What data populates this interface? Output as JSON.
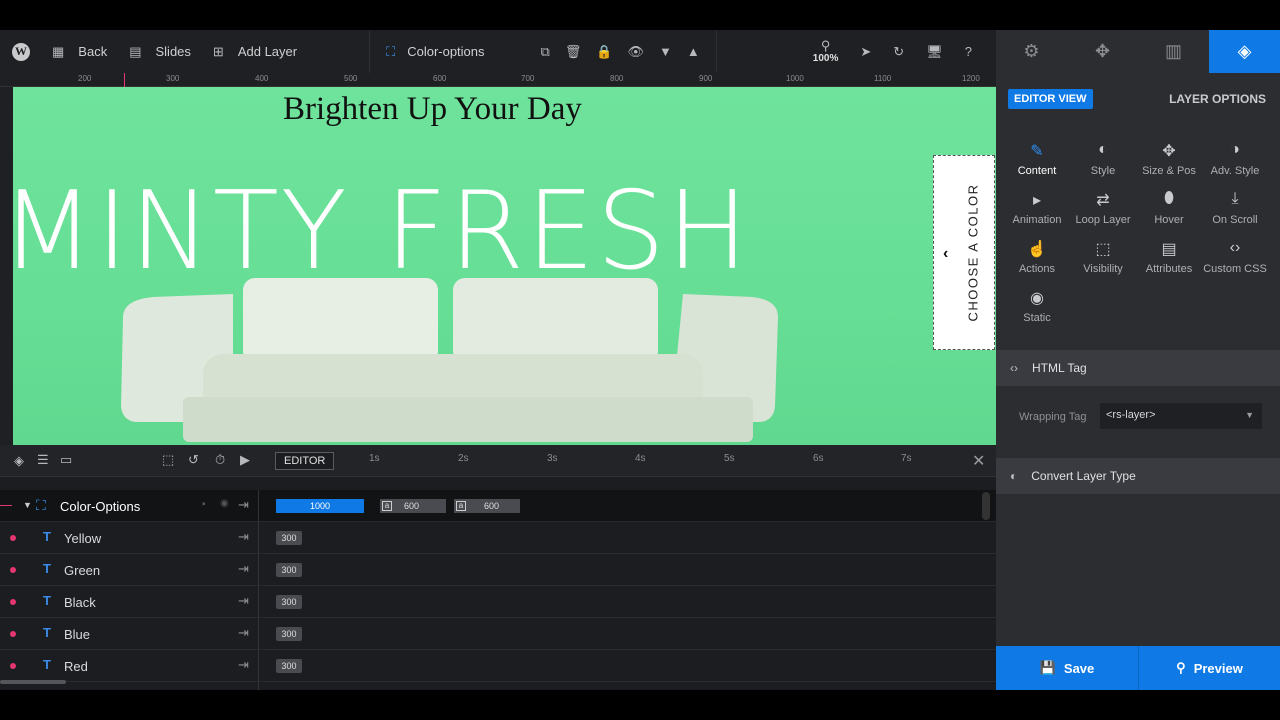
{
  "toolbar": {
    "back_label": "Back",
    "slides_label": "Slides",
    "add_layer_label": "Add Layer",
    "layer_name": "Color-options",
    "zoom": "100%"
  },
  "ruler": {
    "labels": [
      "200",
      "300",
      "400",
      "500",
      "600",
      "700",
      "800",
      "900",
      "1000",
      "1100",
      "1200"
    ]
  },
  "slide": {
    "title": "Brighten Up Your Day",
    "big_text": "MINTY FRESH",
    "tab_text": "CHOOSE A COLOR"
  },
  "timeline": {
    "editor_label": "EDITOR",
    "seconds": [
      "1s",
      "2s",
      "3s",
      "4s",
      "5s",
      "6s",
      "7s"
    ],
    "group": {
      "name": "Color-Options",
      "bar_main": "1000",
      "bar_a1": "600",
      "bar_a2": "600",
      "a_marker": "a"
    },
    "layers": [
      {
        "name": "Yellow",
        "value": "300",
        "type_icon": "T"
      },
      {
        "name": "Green",
        "value": "300",
        "type_icon": "T"
      },
      {
        "name": "Black",
        "value": "300",
        "type_icon": "T"
      },
      {
        "name": "Blue",
        "value": "300",
        "type_icon": "T"
      },
      {
        "name": "Red",
        "value": "300",
        "type_icon": "T"
      }
    ]
  },
  "right_panel": {
    "editor_view": "EDITOR VIEW",
    "layer_options": "LAYER OPTIONS",
    "options": [
      {
        "label": "Content",
        "icon": "pencil-icon"
      },
      {
        "label": "Style",
        "icon": "palette-icon"
      },
      {
        "label": "Size & Pos",
        "icon": "move-icon"
      },
      {
        "label": "Adv. Style",
        "icon": "contrast-icon"
      },
      {
        "label": "Animation",
        "icon": "play-icon"
      },
      {
        "label": "Loop Layer",
        "icon": "loop-icon"
      },
      {
        "label": "Hover",
        "icon": "mouse-icon"
      },
      {
        "label": "On Scroll",
        "icon": "scroll-icon"
      },
      {
        "label": "Actions",
        "icon": "hand-icon"
      },
      {
        "label": "Visibility",
        "icon": "visibility-icon"
      },
      {
        "label": "Attributes",
        "icon": "document-icon"
      },
      {
        "label": "Custom CSS",
        "icon": "code-icon"
      },
      {
        "label": "Static",
        "icon": "static-icon"
      }
    ],
    "html_tag_title": "HTML Tag",
    "wrapping_tag_label": "Wrapping Tag",
    "wrapping_tag_value": "<rs-layer>",
    "convert_title": "Convert Layer Type",
    "save_label": "Save",
    "preview_label": "Preview"
  },
  "colors": {
    "accent": "#0f7ae5",
    "canvas_bg": "#6fe39c",
    "dot": "#e4376f"
  }
}
